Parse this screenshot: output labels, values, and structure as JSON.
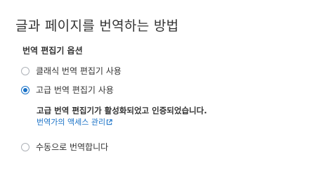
{
  "page": {
    "title": "글과 페이지를 번역하는 방법"
  },
  "editor_options": {
    "heading": "번역 편집기 옵션",
    "options": [
      {
        "label": "클래식 번역 편집기 사용",
        "selected": false
      },
      {
        "label": "고급 번역 편집기 사용",
        "selected": true
      },
      {
        "label": "수동으로 번역합니다",
        "selected": false
      }
    ],
    "advanced_status": "고급 번역 편집기가 활성화되었고 인증되었습니다.",
    "access_link": "번역가의 액세스 관리"
  },
  "colors": {
    "accent": "#1a72c7",
    "text": "#333333",
    "radio_border": "#aeb2b8"
  },
  "icons": {
    "external_link": "external-link-icon"
  }
}
